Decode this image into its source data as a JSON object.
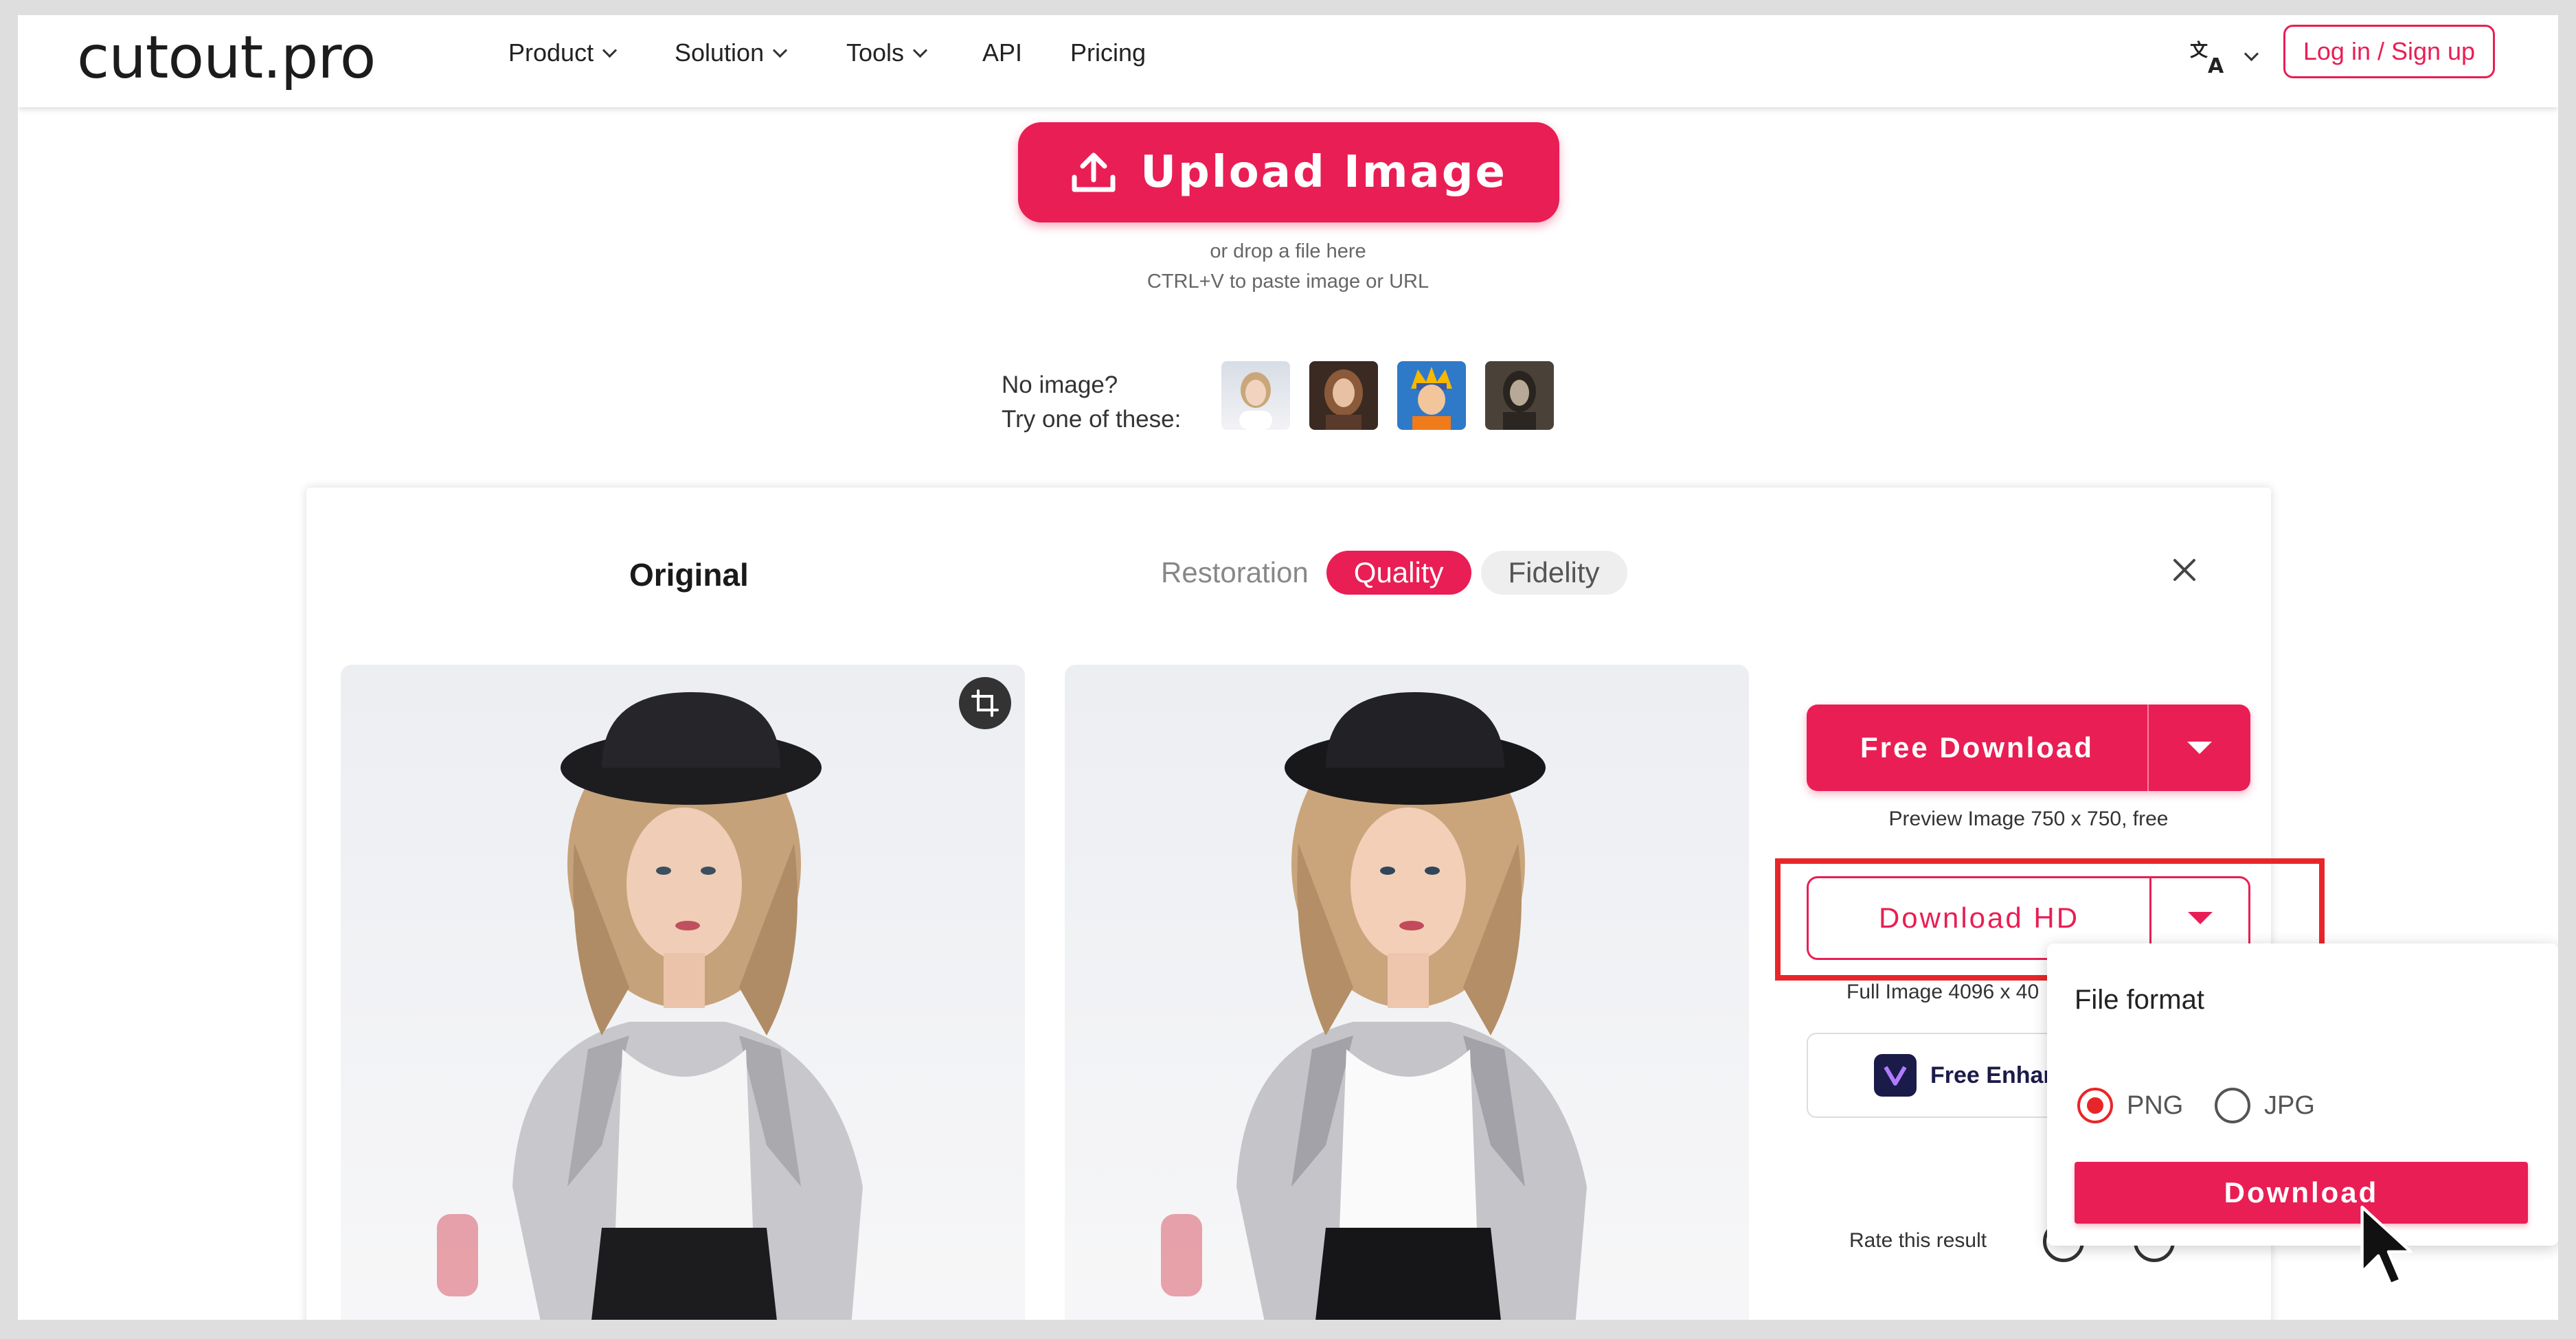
{
  "header": {
    "logo": "cutout.pro",
    "nav": [
      "Product",
      "Solution",
      "Tools",
      "API",
      "Pricing"
    ],
    "login_label": "Log in / Sign up"
  },
  "upload": {
    "button_label": "Upload Image",
    "hint_drop": "or drop a file here",
    "hint_paste": "CTRL+V to paste image or URL",
    "no_image_line1": "No image?",
    "no_image_line2": "Try one of these:"
  },
  "card": {
    "original_label": "Original",
    "tabs": [
      "Restoration",
      "Quality",
      "Fidelity"
    ],
    "active_tab": "Quality",
    "free_download_label": "Free Download",
    "preview_note": "Preview Image 750 x 750, free",
    "download_hd_label": "Download HD",
    "full_image_note": "Full Image 4096 x 40",
    "enhance_label": "Free Enhan",
    "rate_label": "Rate this result"
  },
  "popup": {
    "title": "File format",
    "options": [
      "PNG",
      "JPG"
    ],
    "selected": "PNG",
    "download_label": "Download"
  },
  "colors": {
    "accent": "#e91e54",
    "highlight": "#e8262a"
  }
}
